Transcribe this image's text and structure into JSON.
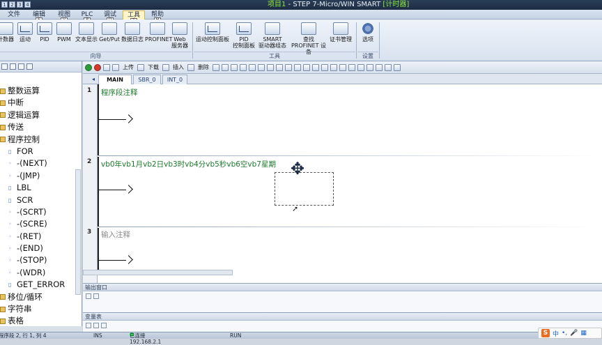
{
  "window": {
    "title_prefix": "项目1",
    "title_mid": " - STEP 7-Micro/WIN SMART",
    "title_hl": "[计时器]"
  },
  "qat": [
    "1",
    "2",
    "3",
    "4"
  ],
  "ribbon_tabs": [
    {
      "label": "文件",
      "key": ""
    },
    {
      "label": "编辑",
      "key": "E"
    },
    {
      "label": "视图",
      "key": "V"
    },
    {
      "label": "PLC",
      "key": "P"
    },
    {
      "label": "调试",
      "key": "D"
    },
    {
      "label": "工具",
      "key": "T"
    },
    {
      "label": "帮助",
      "key": "H"
    }
  ],
  "ribbon_buttons": [
    "计数器",
    "运动",
    "PID",
    "PWM",
    "文本显示",
    "Get/Put",
    "数据日志",
    "PROFINET",
    "Web\n服务器",
    "运动控制面板",
    "PID\n控制面板",
    "SMART\n驱动器组态",
    "查找\nPROFINET 设备",
    "证书管理",
    "选项"
  ],
  "ribbon_groups": [
    "向导",
    "工具",
    "设置"
  ],
  "editor_toolbar": {
    "upload": "上传",
    "download": "下载",
    "insert": "插入",
    "delete": "删除"
  },
  "program_tabs": [
    "MAIN",
    "SBR_0",
    "INT_0"
  ],
  "networks": [
    {
      "num": "1",
      "comment": "程序段注释"
    },
    {
      "num": "2",
      "comment": "vb0年vb1月vb2日vb3时vb4分vb5秒vb6空vb7星期"
    },
    {
      "num": "3",
      "comment": "输入注释"
    }
  ],
  "tree": [
    {
      "label": "整数运算",
      "type": "folder"
    },
    {
      "label": "中断",
      "type": "folder"
    },
    {
      "label": "逻辑运算",
      "type": "folder"
    },
    {
      "label": "传送",
      "type": "folder"
    },
    {
      "label": "程序控制",
      "type": "folder"
    },
    {
      "label": "FOR",
      "type": "box"
    },
    {
      "label": "-(NEXT)",
      "type": "coil"
    },
    {
      "label": "-(JMP)",
      "type": "coil"
    },
    {
      "label": "LBL",
      "type": "box"
    },
    {
      "label": "SCR",
      "type": "box"
    },
    {
      "label": "-(SCRT)",
      "type": "coil"
    },
    {
      "label": "-(SCRE)",
      "type": "coil"
    },
    {
      "label": "-(RET)",
      "type": "coil"
    },
    {
      "label": "-(END)",
      "type": "coil"
    },
    {
      "label": "-(STOP)",
      "type": "coil"
    },
    {
      "label": "-(WDR)",
      "type": "coil"
    },
    {
      "label": "GET_ERROR",
      "type": "box"
    },
    {
      "label": "移位/循环",
      "type": "folder"
    },
    {
      "label": "字符串",
      "type": "folder"
    },
    {
      "label": "表格",
      "type": "folder"
    }
  ],
  "panes": {
    "output": "输出窗口",
    "vartable": "变量表"
  },
  "status": {
    "position": "程序段 2, 行 1, 列 4",
    "mode": "INS",
    "connection": "已连接 192.168.2.1",
    "run": "RUN"
  },
  "ime": {
    "logo": "S",
    "lang": "中",
    "dot": "•,",
    "mic": "🎤",
    "grid": "▦"
  },
  "colors": {
    "comment_green": "#1d7a2b",
    "title_green": "#8de83d",
    "active_tab": "#fff5c6"
  }
}
